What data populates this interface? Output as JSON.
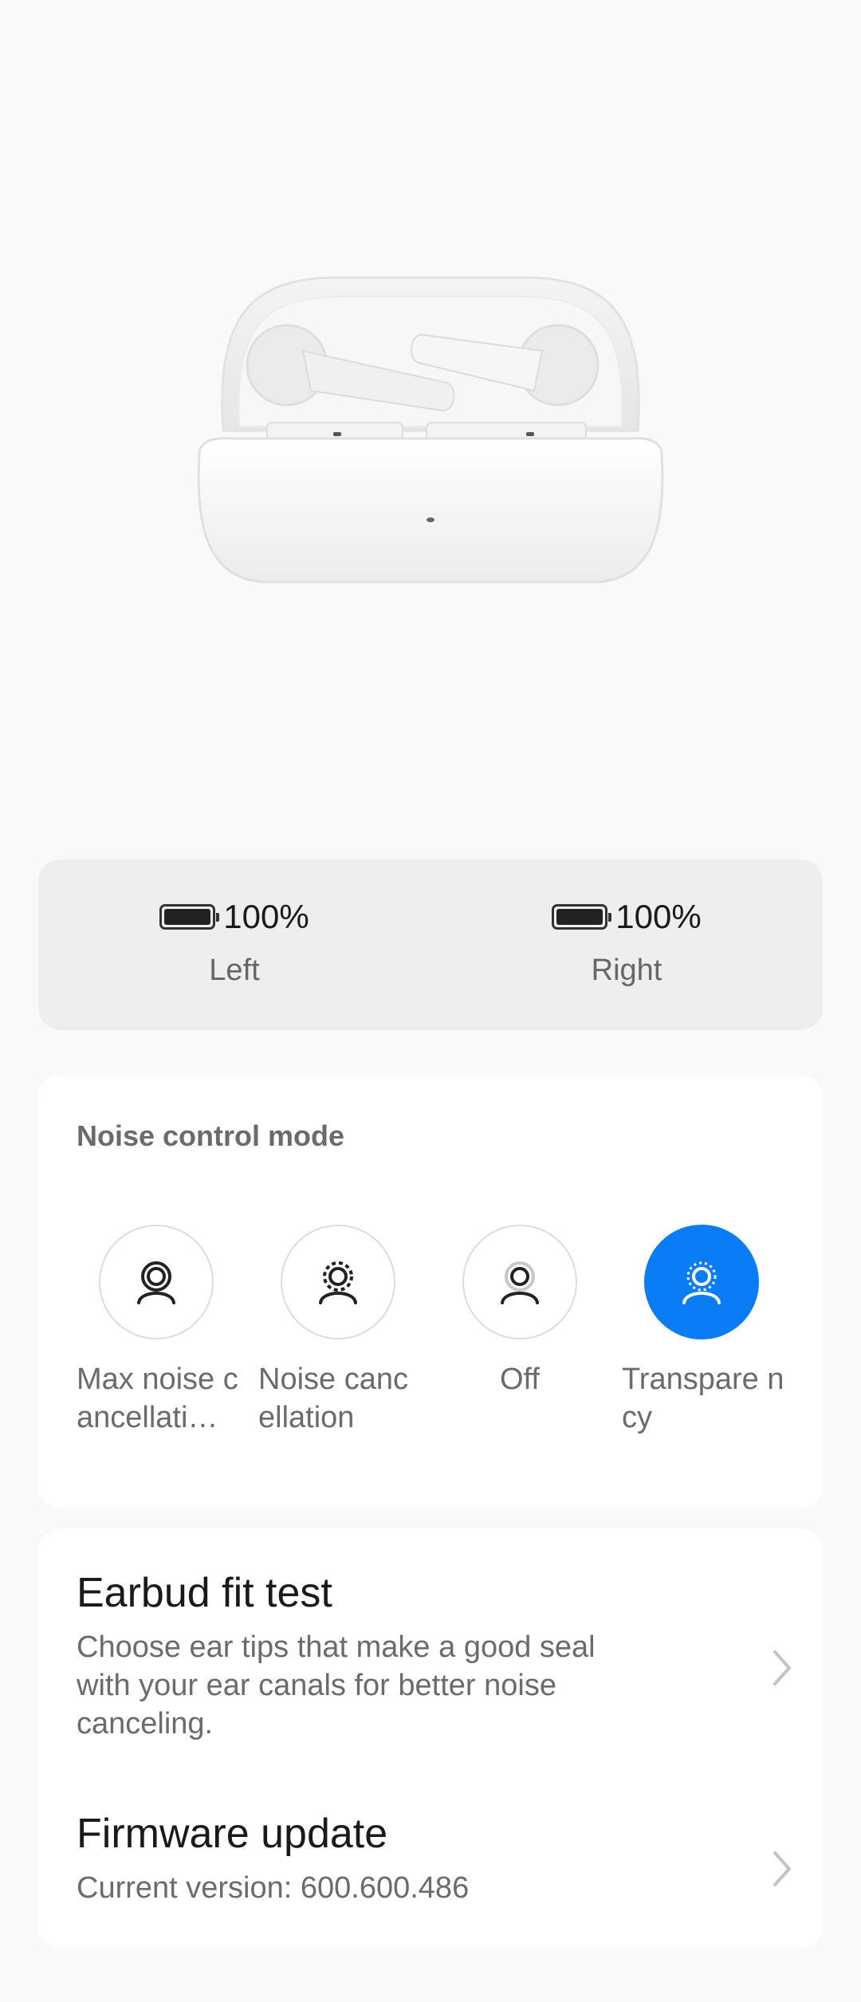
{
  "battery": {
    "left": {
      "percent_label": "100%",
      "side_label": "Left",
      "level": 1.0
    },
    "right": {
      "percent_label": "100%",
      "side_label": "Right",
      "level": 1.0
    }
  },
  "noise_control": {
    "title": "Noise control mode",
    "modes": [
      {
        "label": "Max noise cancellati…",
        "icon": "max-noise-cancellation-icon",
        "active": false
      },
      {
        "label": "Noise canc ellation",
        "icon": "noise-cancellation-icon",
        "active": false
      },
      {
        "label": "Off",
        "icon": "noise-off-icon",
        "active": false
      },
      {
        "label": "Transpare ncy",
        "icon": "transparency-icon",
        "active": true
      }
    ],
    "accent_color": "#0a7cf5"
  },
  "options": {
    "fit_test": {
      "title": "Earbud fit test",
      "description": "Choose ear tips that make a good seal with your ear canals for better noise canceling."
    },
    "firmware": {
      "title": "Firmware update",
      "description": "Current version: 600.600.486"
    }
  }
}
